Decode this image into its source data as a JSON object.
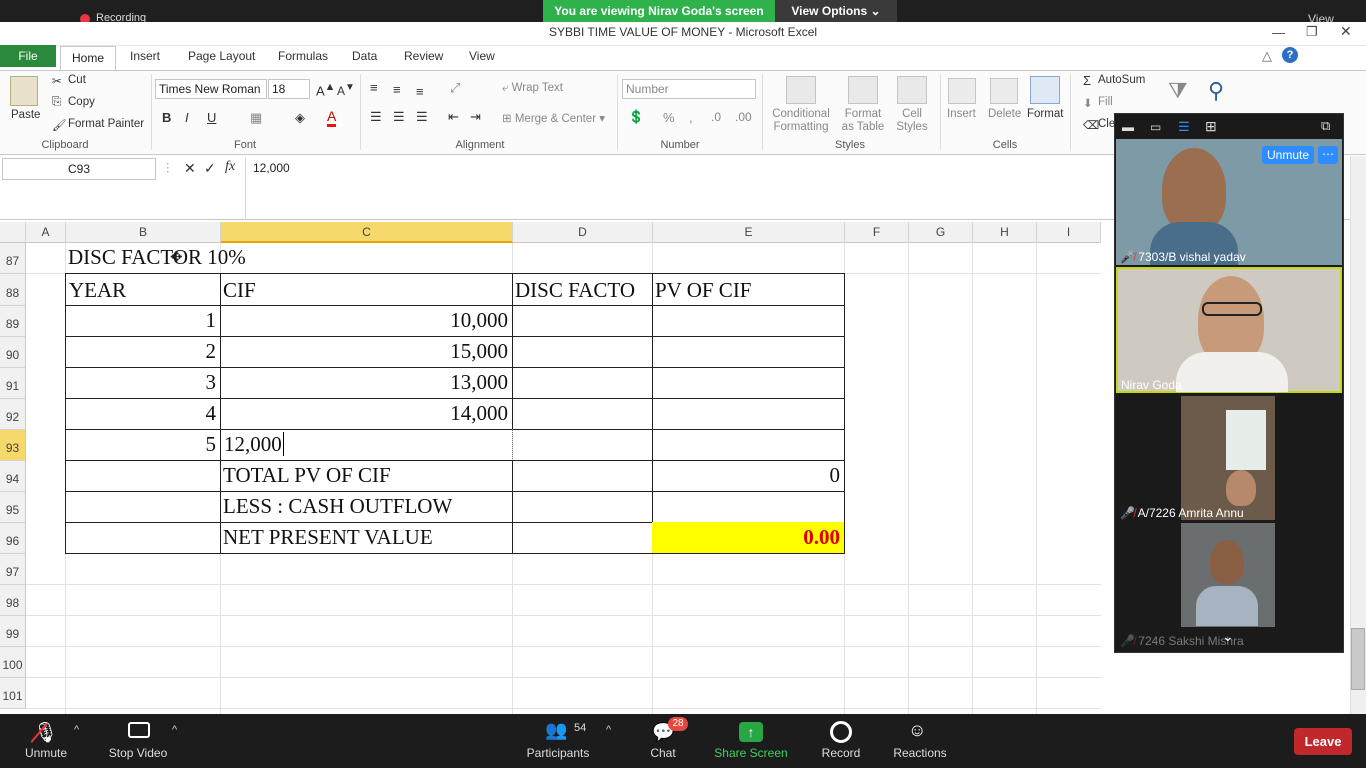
{
  "zoom": {
    "banner": "You are viewing Nirav Goda's screen",
    "view_options": "View Options",
    "recording": "Recording",
    "view": "View",
    "unmute_chip": "Unmute",
    "participants": [
      {
        "name": "7303/B vishal yadav",
        "muted": true
      },
      {
        "name": "Nirav Goda",
        "muted": false
      },
      {
        "name": "A/7226 Amrita Annu",
        "muted": true
      },
      {
        "name": "7246 Sakshi Mishra",
        "muted": true
      }
    ],
    "toolbar": {
      "unmute": "Unmute",
      "stop_video": "Stop Video",
      "participants": "Participants",
      "participants_count": "54",
      "chat": "Chat",
      "chat_badge": "28",
      "share_screen": "Share Screen",
      "record": "Record",
      "reactions": "Reactions",
      "leave": "Leave"
    }
  },
  "excel": {
    "title": "SYBBI TIME VALUE OF MONEY  -  Microsoft Excel",
    "tabs": [
      "File",
      "Home",
      "Insert",
      "Page Layout",
      "Formulas",
      "Data",
      "Review",
      "View"
    ],
    "ribbon": {
      "clipboard": {
        "paste": "Paste",
        "cut": "Cut",
        "copy": "Copy",
        "format_painter": "Format Painter",
        "label": "Clipboard"
      },
      "font": {
        "name": "Times New Roman",
        "size": "18",
        "label": "Font"
      },
      "alignment": {
        "wrap": "Wrap Text",
        "merge": "Merge & Center",
        "label": "Alignment"
      },
      "number": {
        "format": "Number",
        "label": "Number"
      },
      "styles": {
        "conditional": "Conditional",
        "formatting": "Formatting",
        "format_as": "Format",
        "as_table": "as Table",
        "cell": "Cell",
        "cell_styles": "Styles",
        "label": "Styles"
      },
      "cells": {
        "insert": "Insert",
        "delete": "Delete",
        "format": "Format",
        "label": "Cells"
      },
      "editing": {
        "autosum": "AutoSum",
        "fill": "Fill",
        "clear": "Cle"
      }
    },
    "name_box": "C93",
    "formula": "12,000",
    "columns": [
      "A",
      "B",
      "C",
      "D",
      "E",
      "F",
      "G",
      "H",
      "I"
    ],
    "rows": [
      "87",
      "88",
      "89",
      "90",
      "91",
      "92",
      "93",
      "94",
      "95",
      "96",
      "97",
      "98",
      "99",
      "100",
      "101"
    ],
    "sheet": {
      "title_cell": "DISC FACTOR 10%",
      "headers": {
        "year": "YEAR",
        "cif": "CIF",
        "disc": "DISC FACTO",
        "pv": "PV OF CIF"
      },
      "data": [
        {
          "year": "1",
          "cif": "10,000"
        },
        {
          "year": "2",
          "cif": "15,000"
        },
        {
          "year": "3",
          "cif": "13,000"
        },
        {
          "year": "4",
          "cif": "14,000"
        },
        {
          "year": "5",
          "cif": "12,000"
        }
      ],
      "total_label": "TOTAL PV OF CIF",
      "total_value": "0",
      "less_label": "LESS : CASH OUTFLOW",
      "npv_label": "NET PRESENT VALUE",
      "npv_value": "0.00"
    }
  }
}
